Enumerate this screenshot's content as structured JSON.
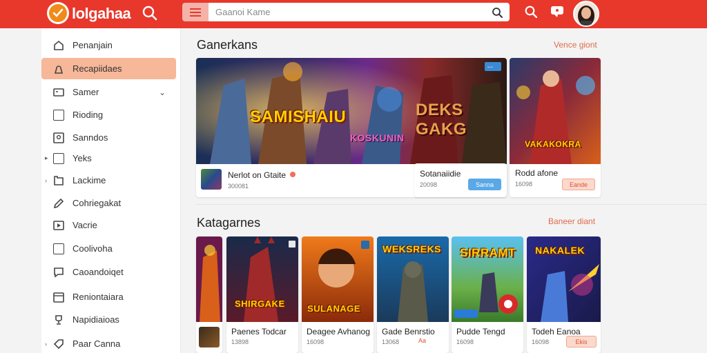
{
  "header": {
    "brand": "lolgahaa",
    "search_placeholder": "Gaanoi Kame"
  },
  "sidebar": {
    "items": [
      {
        "label": "Penanjain"
      },
      {
        "label": "Recapiidaes"
      },
      {
        "label": "Samer"
      },
      {
        "label": "Rioding"
      },
      {
        "label": "Sanndos"
      },
      {
        "label": "Yeks"
      },
      {
        "label": "Lackime"
      },
      {
        "label": "Cohriegakat"
      },
      {
        "label": "Vacrie"
      },
      {
        "label": "Coolivoha"
      },
      {
        "label": "Caoandoiqet"
      },
      {
        "label": "Reniontaiara"
      },
      {
        "label": "Napidiaioas"
      },
      {
        "label": "Paar Canna"
      }
    ]
  },
  "featured": {
    "title": "Ganerkans",
    "link": "Vence giont",
    "cards": [
      {
        "art_text_1": "SAMISHAIU",
        "art_text_2": "DEKS GAKG",
        "art_text_3": "KOSKUNIN",
        "title": "Nerlot on Gtaite",
        "sub": "300081",
        "art_badge": "..."
      },
      {
        "title": "Sotanaiidie",
        "sub": "20098",
        "badge": "Sanna"
      },
      {
        "art_text": "VAKAKOKRA",
        "title": "Rodd afone",
        "sub": "16098",
        "badge": "Eande"
      }
    ]
  },
  "categories": {
    "title": "Katagarnes",
    "link": "Baneer diant",
    "cards": [
      {
        "title": "",
        "sub": ""
      },
      {
        "art_text": "SHIRGAKE",
        "title": "Paenes Todcar",
        "sub": "13898"
      },
      {
        "art_text": "SULANAGE",
        "title": "Deagee Avhanog",
        "sub": "16098"
      },
      {
        "art_text": "WEKSREKS",
        "title": "Gade Benrstio",
        "sub": "13068",
        "badge": "Aa"
      },
      {
        "art_text": "SIRRAMT",
        "title": "Pudde Tengd",
        "sub": "16098"
      },
      {
        "art_text": "NAKALEK",
        "title": "Todeh Eanoa",
        "sub": "16098",
        "badge": "Ekis"
      }
    ]
  }
}
